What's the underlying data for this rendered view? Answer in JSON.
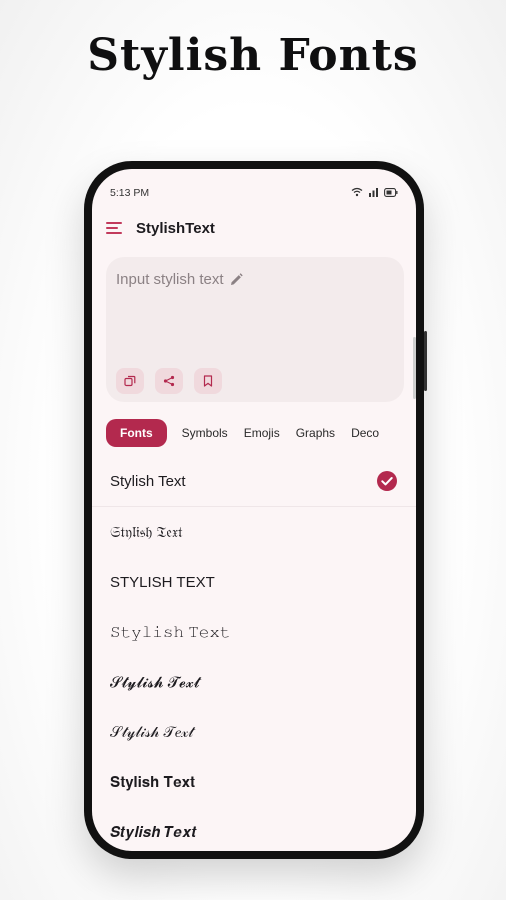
{
  "headline": "Stylish Fonts",
  "status": {
    "time": "5:13 PM"
  },
  "app": {
    "title": "StylishText"
  },
  "input": {
    "placeholder": "Input stylish text"
  },
  "tabs": [
    "Fonts",
    "Symbols",
    "Emojis",
    "Graphs",
    "Deco"
  ],
  "fonts": [
    "Stylish Text",
    "𝔖𝔱𝔶𝔩𝔦𝔰𝔥 𝔗𝔢𝔵𝔱",
    "STYLISH TEXT",
    "𝚂𝚝𝚢𝚕𝚒𝚜𝚑 𝚃𝚎𝚡𝚝",
    "𝓢𝓽𝔂𝓵𝓲𝓼𝓱 𝓣𝓮𝔁𝓽",
    "𝒮𝓉𝓎𝓁𝒾𝓈𝒽 𝒯𝑒𝓍𝓉",
    "𝐒𝐭𝐲𝐥𝐢𝐬𝐡 𝐓𝐞𝐱𝐭",
    "𝑺𝒕𝒚𝒍𝒊𝒔𝒉 𝑻𝒆𝒙𝒕"
  ],
  "colors": {
    "accent": "#b3294e",
    "background": "#fcf5f6",
    "card": "#f3ebec",
    "action": "#f0d9dd"
  }
}
